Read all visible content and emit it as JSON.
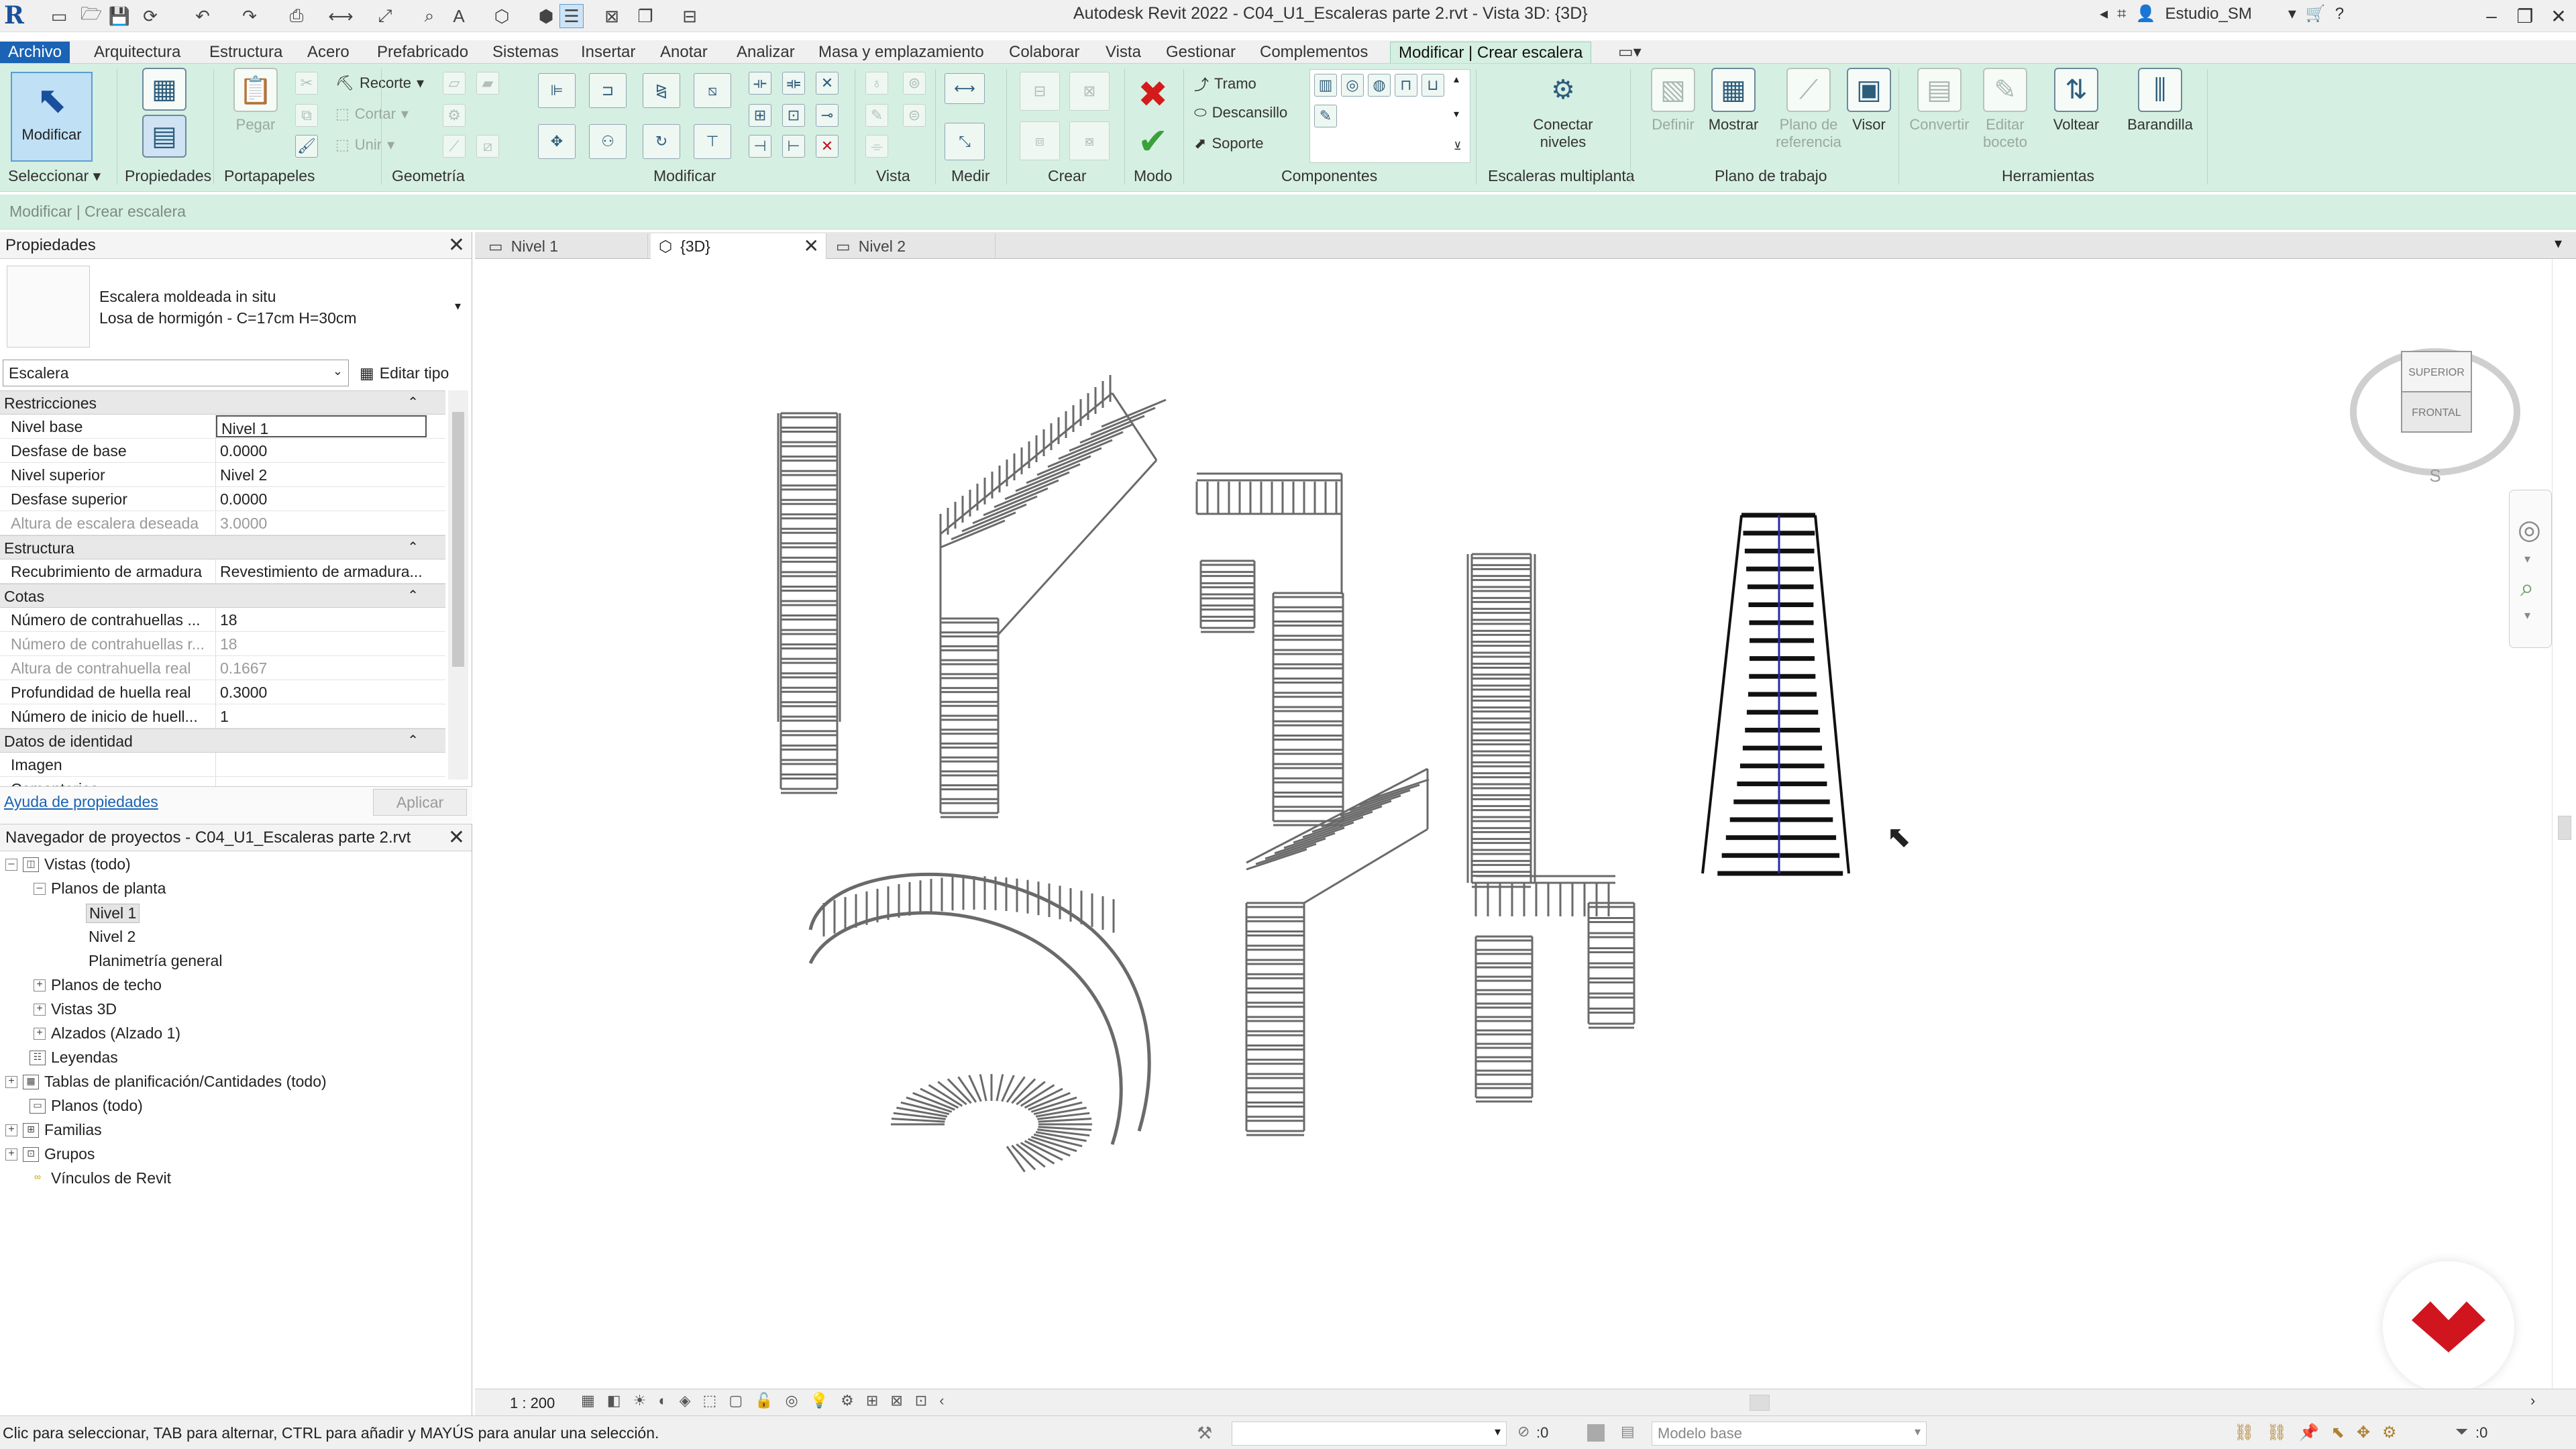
{
  "titlebar": {
    "title": "Autodesk Revit 2022 - C04_U1_Escaleras parte 2.rvt - Vista 3D: {3D}",
    "user": "Estudio_SM"
  },
  "menu": {
    "tabs": [
      "Archivo",
      "Arquitectura",
      "Estructura",
      "Acero",
      "Prefabricado",
      "Sistemas",
      "Insertar",
      "Anotar",
      "Analizar",
      "Masa y emplazamiento",
      "Colaborar",
      "Vista",
      "Gestionar",
      "Complementos",
      "Modificar | Crear escalera"
    ]
  },
  "ribbon": {
    "modificar": "Modificar",
    "propiedades": "Propiedades",
    "pegar": "Pegar",
    "recorte": "Recorte",
    "cortar": "Cortar",
    "unir": "Unir",
    "tramo": "Tramo",
    "descansillo": "Descansillo",
    "soporte": "Soporte",
    "conectar_niveles": [
      "Conectar",
      "niveles"
    ],
    "definir": "Definir",
    "mostrar": "Mostrar",
    "plano_ref": [
      "Plano de",
      "referencia"
    ],
    "visor": "Visor",
    "convertir": "Convertir",
    "editar_boceto": [
      "Editar",
      "boceto"
    ],
    "voltear": "Voltear",
    "barandilla": "Barandilla",
    "panels": [
      "Seleccionar",
      "Propiedades",
      "Portapapeles",
      "Geometría",
      "Modificar",
      "Vista",
      "Medir",
      "Crear",
      "Modo",
      "Componentes",
      "Escaleras multiplanta",
      "Plano de trabajo",
      "Herramientas"
    ]
  },
  "contextbar": "Modificar | Crear escalera",
  "properties": {
    "title": "Propiedades",
    "type_line1": "Escalera moldeada in situ",
    "type_line2": "Losa de hormigón - C=17cm H=30cm",
    "category": "Escalera",
    "edit_type": "Editar tipo",
    "sections": {
      "restricciones": "Restricciones",
      "estructura": "Estructura",
      "cotas": "Cotas",
      "identidad": "Datos de identidad"
    },
    "rows": {
      "nivel_base": [
        "Nivel base",
        "Nivel 1"
      ],
      "desfase_base": [
        "Desfase de base",
        "0.0000"
      ],
      "nivel_superior": [
        "Nivel superior",
        "Nivel 2"
      ],
      "desfase_superior": [
        "Desfase superior",
        "0.0000"
      ],
      "altura_deseada": [
        "Altura de escalera deseada",
        "3.0000"
      ],
      "recubrimiento": [
        "Recubrimiento de armadura",
        "Revestimiento de armadura..."
      ],
      "num_contrahuellas": [
        "Número de contrahuellas ...",
        "18"
      ],
      "num_contrahuellas_r": [
        "Número de contrahuellas r...",
        "18"
      ],
      "altura_contrahuella": [
        "Altura de contrahuella real",
        "0.1667"
      ],
      "profundidad_huella": [
        "Profundidad de huella real",
        "0.3000"
      ],
      "inicio_huella": [
        "Número de inicio de huell...",
        "1"
      ],
      "imagen": [
        "Imagen",
        ""
      ],
      "comentarios": [
        "Comentarios",
        ""
      ]
    },
    "help": "Ayuda de propiedades",
    "apply": "Aplicar"
  },
  "browser": {
    "title": "Navegador de proyectos - C04_U1_Escaleras parte 2.rvt",
    "items": [
      "Vistas (todo)",
      "Planos de planta",
      "Nivel 1",
      "Nivel 2",
      "Planimetría general",
      "Planos de techo",
      "Vistas 3D",
      "Alzados (Alzado 1)",
      "Leyendas",
      "Tablas de planificación/Cantidades (todo)",
      "Planos (todo)",
      "Familias",
      "Grupos",
      "Vínculos de Revit"
    ]
  },
  "viewtabs": [
    "Nivel 1",
    "{3D}",
    "Nivel 2"
  ],
  "viewcube": {
    "top": "SUPERIOR",
    "front": "FRONTAL"
  },
  "viewbar": {
    "scale": "1 : 200"
  },
  "status": {
    "text": "Clic para seleccionar, TAB para alternar, CTRL para añadir y MAYÚS para anular una selección.",
    "selected": ":0",
    "model": "Modelo base",
    "filter": ":0"
  },
  "colors": {
    "accent": "#1a63b5",
    "ribbon": "#d6efe3",
    "logo": "#d0151f"
  }
}
